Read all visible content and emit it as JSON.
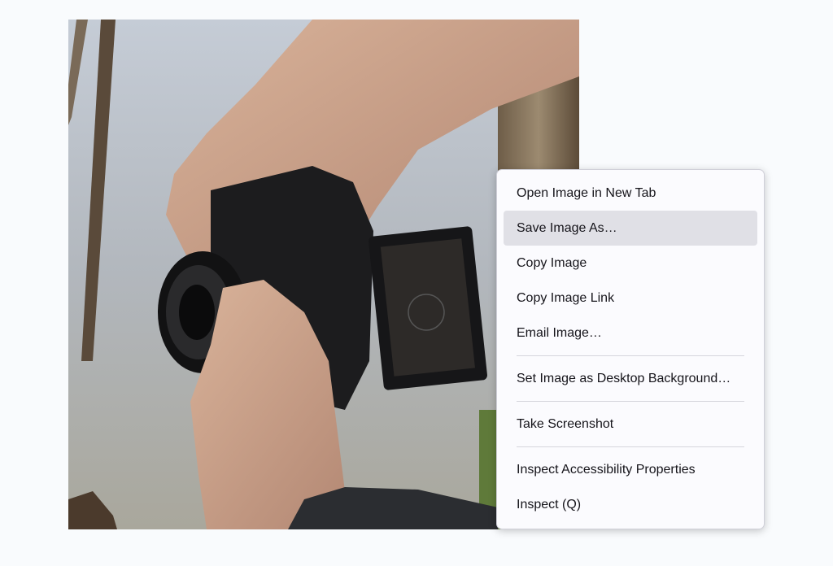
{
  "context_menu": {
    "items": [
      {
        "label": "Open Image in New Tab"
      },
      {
        "label": "Save Image As…",
        "hovered": true
      },
      {
        "label": "Copy Image"
      },
      {
        "label": "Copy Image Link"
      },
      {
        "label": "Email Image…"
      },
      {
        "label": "Set Image as Desktop Background…"
      },
      {
        "label": "Take Screenshot"
      },
      {
        "label": "Inspect Accessibility Properties"
      },
      {
        "label": "Inspect (Q)"
      }
    ]
  },
  "colors": {
    "page_background": "#f9fbfd",
    "menu_background": "#fbfbfe",
    "menu_hover": "#e0e0e6",
    "menu_text": "#15141a"
  },
  "image": {
    "subject": "hands holding camera with flip-out screen"
  }
}
